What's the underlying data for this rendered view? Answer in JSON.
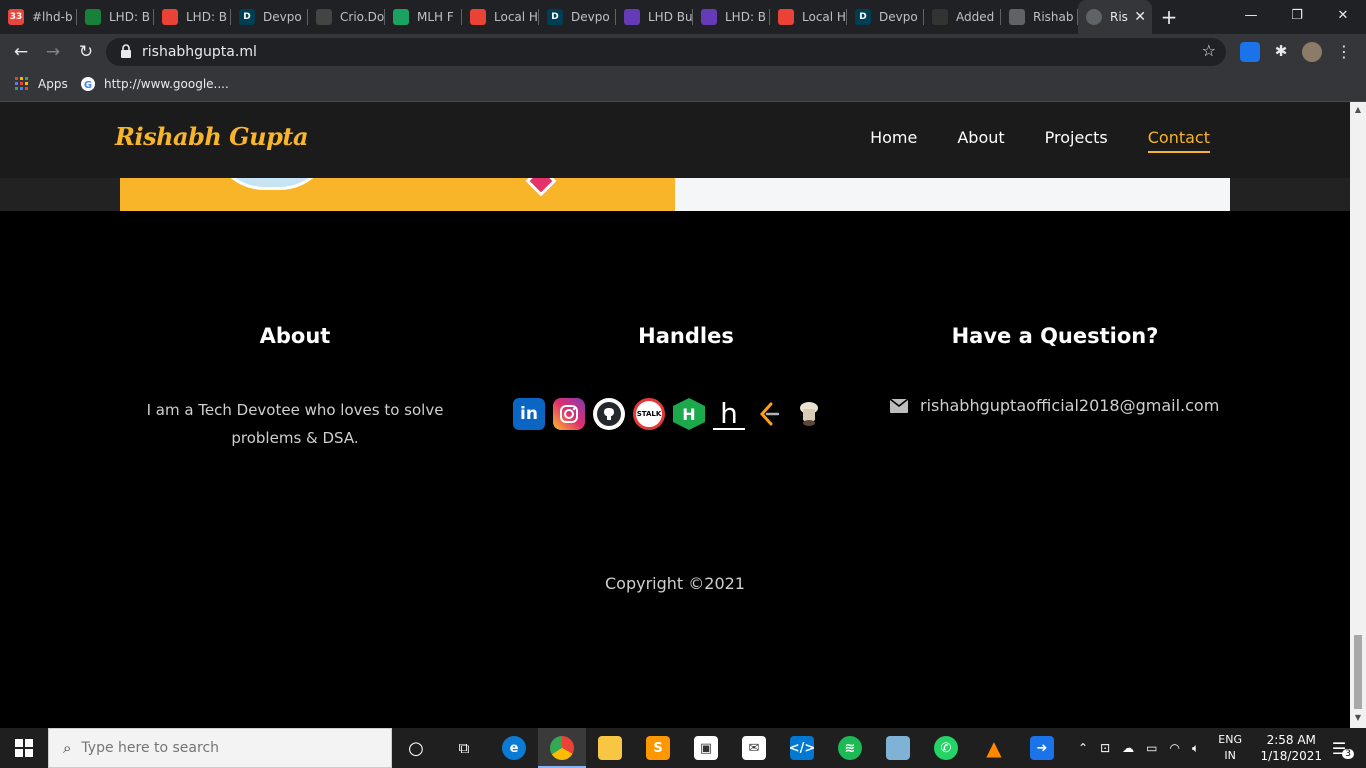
{
  "browser": {
    "tabs": [
      {
        "label": "#lhd-b",
        "color": "#e8453c",
        "badge": "33"
      },
      {
        "label": "LHD: B",
        "color": "#188038"
      },
      {
        "label": "LHD: B",
        "color": "#ea4335"
      },
      {
        "label": "Devpo",
        "color": "#003e54",
        "badge": "D"
      },
      {
        "label": "Crio.Do",
        "color": "#444"
      },
      {
        "label": "MLH F",
        "color": "#1aa260"
      },
      {
        "label": "Local H",
        "color": "#ea4335"
      },
      {
        "label": "Devpo",
        "color": "#003e54",
        "badge": "D"
      },
      {
        "label": "LHD Bu",
        "color": "#673ab7"
      },
      {
        "label": "LHD: B",
        "color": "#673ab7"
      },
      {
        "label": "Local H",
        "color": "#ea4335"
      },
      {
        "label": "Devpo",
        "color": "#003e54",
        "badge": "D"
      },
      {
        "label": "Added",
        "color": "#333"
      },
      {
        "label": "Rishab",
        "color": "#5f6368"
      }
    ],
    "active_tab": {
      "label": "Ris"
    },
    "url": "rishabhgupta.ml",
    "bookmarks": [
      {
        "label": "Apps"
      },
      {
        "label": "http://www.google...."
      }
    ]
  },
  "site": {
    "brand": "Rishabh Gupta",
    "nav": [
      {
        "label": "Home"
      },
      {
        "label": "About"
      },
      {
        "label": "Projects"
      },
      {
        "label": "Contact"
      }
    ],
    "footer": {
      "about_heading": "About",
      "about_text": "I am a Tech Devotee who loves to solve problems & DSA.",
      "handles_heading": "Handles",
      "handles": [
        {
          "name": "linkedin",
          "glyph": "in",
          "color": "#0a66c2"
        },
        {
          "name": "instagram",
          "glyph": "",
          "color": "#d6249f"
        },
        {
          "name": "github",
          "glyph": "",
          "color": "#fff"
        },
        {
          "name": "stalk",
          "glyph": "STALK",
          "color": "#ffffff"
        },
        {
          "name": "hackerrank",
          "glyph": "H",
          "color": "#1ba94c"
        },
        {
          "name": "hackerearth",
          "glyph": "h",
          "color": "#000"
        },
        {
          "name": "leetcode",
          "glyph": "",
          "color": "#000"
        },
        {
          "name": "codechef",
          "glyph": "",
          "color": "#000"
        }
      ],
      "question_heading": "Have a Question?",
      "email": "rishabhguptaofficial2018@gmail.com",
      "copyright": "Copyright ©2021"
    }
  },
  "taskbar": {
    "search_placeholder": "Type here to search",
    "lang_top": "ENG",
    "lang_bottom": "IN",
    "time": "2:58 AM",
    "date": "1/18/2021",
    "notifications": "3"
  }
}
